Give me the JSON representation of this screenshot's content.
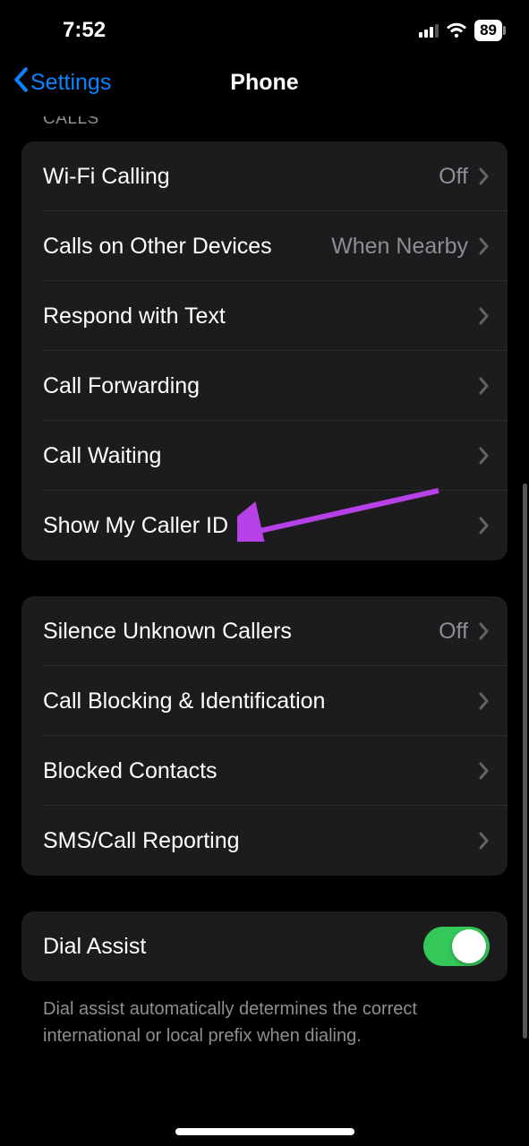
{
  "status_bar": {
    "time": "7:52",
    "battery": "89"
  },
  "nav": {
    "back_label": "Settings",
    "title": "Phone"
  },
  "sections": {
    "calls_header": "CALLS",
    "group1": [
      {
        "label": "Wi-Fi Calling",
        "value": "Off"
      },
      {
        "label": "Calls on Other Devices",
        "value": "When Nearby"
      },
      {
        "label": "Respond with Text",
        "value": ""
      },
      {
        "label": "Call Forwarding",
        "value": ""
      },
      {
        "label": "Call Waiting",
        "value": ""
      },
      {
        "label": "Show My Caller ID",
        "value": ""
      }
    ],
    "group2": [
      {
        "label": "Silence Unknown Callers",
        "value": "Off"
      },
      {
        "label": "Call Blocking & Identification",
        "value": ""
      },
      {
        "label": "Blocked Contacts",
        "value": ""
      },
      {
        "label": "SMS/Call Reporting",
        "value": ""
      }
    ],
    "group3": {
      "label": "Dial Assist",
      "toggle_on": true
    },
    "footer": "Dial assist automatically determines the correct international or local prefix when dialing."
  }
}
